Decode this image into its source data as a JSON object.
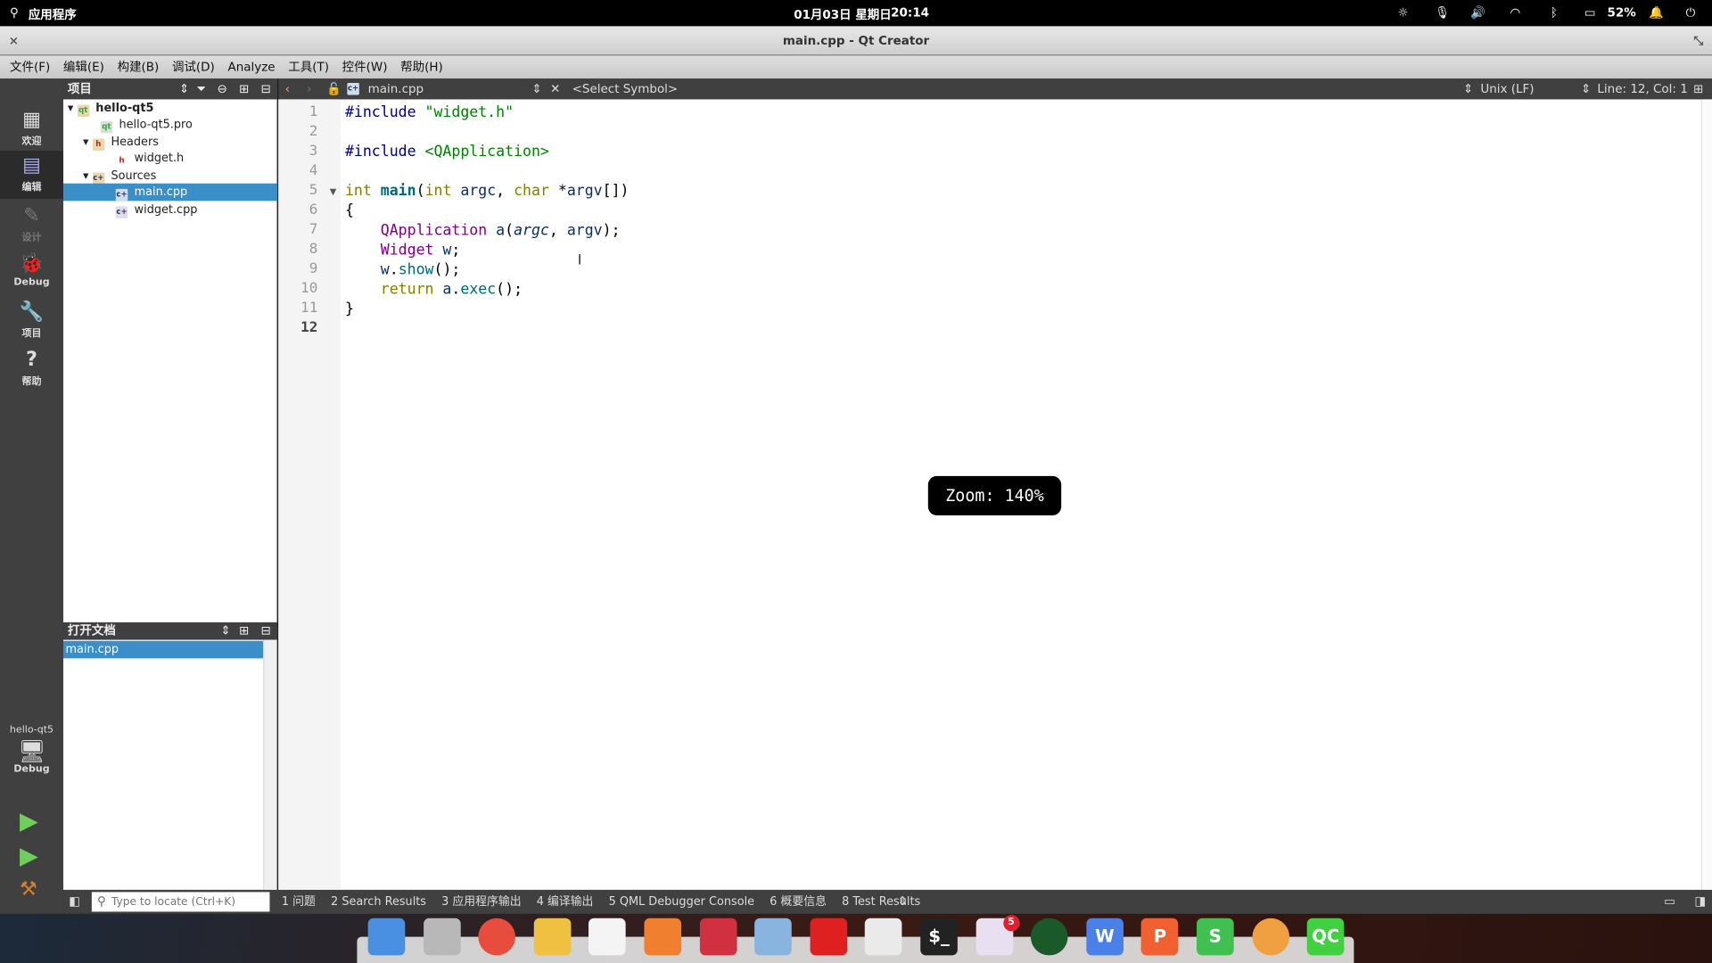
{
  "topbar": {
    "apps": "应用程序",
    "date": "01月03日 星期日",
    "time": "20:14",
    "battery": "52%"
  },
  "window": {
    "title": "main.cpp - Qt Creator"
  },
  "menu": [
    "文件(F)",
    "编辑(E)",
    "构建(B)",
    "调试(D)",
    "Analyze",
    "工具(T)",
    "控件(W)",
    "帮助(H)"
  ],
  "modes": [
    {
      "label": "欢迎",
      "icon": "grid-icon"
    },
    {
      "label": "编辑",
      "icon": "edit-icon"
    },
    {
      "label": "设计",
      "icon": "pencil-icon"
    },
    {
      "label": "Debug",
      "icon": "bug-icon"
    },
    {
      "label": "项目",
      "icon": "wrench-icon"
    },
    {
      "label": "帮助",
      "icon": "help-icon"
    }
  ],
  "kit": {
    "project": "hello-qt5",
    "config": "Debug"
  },
  "projects": {
    "title": "项目",
    "tree": [
      {
        "label": "hello-qt5"
      },
      {
        "label": "hello-qt5.pro"
      },
      {
        "label": "Headers"
      },
      {
        "label": "widget.h"
      },
      {
        "label": "Sources"
      },
      {
        "label": "main.cpp"
      },
      {
        "label": "widget.cpp"
      }
    ]
  },
  "open_docs": {
    "title": "打开文档",
    "items": [
      "main.cpp"
    ]
  },
  "editor": {
    "file": "main.cpp",
    "symbol": "<Select Symbol>",
    "line_ending": "Unix (LF)",
    "position": "Line: 12, Col: 1",
    "zoom": "Zoom: 140%",
    "lines": [
      [
        [
          "pp",
          "#include "
        ],
        [
          "st",
          "\"widget.h\""
        ]
      ],
      [],
      [
        [
          "pp",
          "#include "
        ],
        [
          "st",
          "<QApplication>"
        ]
      ],
      [],
      [
        [
          "k",
          "int "
        ],
        [
          "fb",
          "main"
        ],
        [
          "",
          "("
        ],
        [
          "k",
          "int "
        ],
        [
          "v",
          "argc"
        ],
        [
          "",
          ", "
        ],
        [
          "k",
          "char "
        ],
        [
          "",
          "*"
        ],
        [
          "v",
          "argv"
        ],
        [
          "",
          "[])"
        ]
      ],
      [
        [
          "",
          "{"
        ]
      ],
      [
        [
          "",
          "    "
        ],
        [
          "ty",
          "QApplication "
        ],
        [
          "v",
          "a"
        ],
        [
          "",
          "("
        ],
        [
          "vi",
          "argc"
        ],
        [
          "",
          ", "
        ],
        [
          "v",
          "argv"
        ],
        [
          "",
          ");"
        ]
      ],
      [
        [
          "",
          "    "
        ],
        [
          "ty",
          "Widget "
        ],
        [
          "v",
          "w"
        ],
        [
          "",
          ";"
        ]
      ],
      [
        [
          "",
          "    "
        ],
        [
          "v",
          "w"
        ],
        [
          "",
          "."
        ],
        [
          "fn",
          "show"
        ],
        [
          "",
          "();"
        ]
      ],
      [
        [
          "",
          "    "
        ],
        [
          "k",
          "return "
        ],
        [
          "v",
          "a"
        ],
        [
          "",
          "."
        ],
        [
          "fn",
          "exec"
        ],
        [
          "",
          "();"
        ]
      ],
      [
        [
          "",
          "}"
        ]
      ],
      []
    ]
  },
  "status": {
    "locator_placeholder": "Type to locate (Ctrl+K)",
    "panes": [
      "1  问题",
      "2  Search Results",
      "3  应用程序输出",
      "4  编译输出",
      "5  QML Debugger Console",
      "6  概要信息",
      "8  Test Results"
    ]
  },
  "dock": [
    {
      "name": "multitask"
    },
    {
      "name": "file-manager"
    },
    {
      "name": "chrome"
    },
    {
      "name": "mail"
    },
    {
      "name": "calendar"
    },
    {
      "name": "music"
    },
    {
      "name": "video"
    },
    {
      "name": "image-viewer"
    },
    {
      "name": "netease-music"
    },
    {
      "name": "control-center"
    },
    {
      "name": "terminal",
      "text": "$_"
    },
    {
      "name": "app-store",
      "badge": "5"
    },
    {
      "name": "camera"
    },
    {
      "name": "wps-writer",
      "text": "W"
    },
    {
      "name": "wps-presentation",
      "text": "P"
    },
    {
      "name": "wps-spreadsheet",
      "text": "S"
    },
    {
      "name": "color-picker"
    },
    {
      "name": "qt-creator",
      "text": "QC"
    }
  ]
}
